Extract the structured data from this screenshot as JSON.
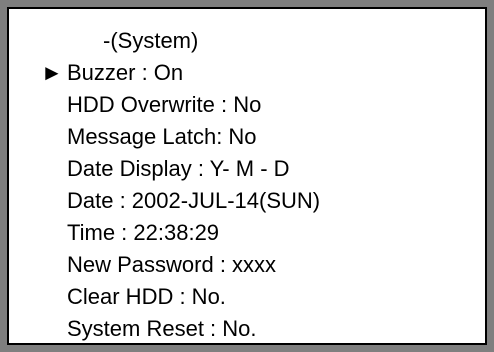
{
  "menu": {
    "title": "-(System)",
    "selected_index": 0,
    "cursor_symbol": "►",
    "items": [
      {
        "label": "Buzzer : On"
      },
      {
        "label": "HDD Overwrite : No"
      },
      {
        "label": "Message Latch: No"
      },
      {
        "label": "Date Display : Y- M - D"
      },
      {
        "label": "Date : 2002-JUL-14(SUN)"
      },
      {
        "label": "Time : 22:38:29"
      },
      {
        "label": "New Password : xxxx"
      },
      {
        "label": "Clear HDD : No."
      },
      {
        "label": "System Reset : No."
      }
    ]
  },
  "colors": {
    "frame": "#7f7f7f",
    "border": "#000000",
    "background": "#ffffff",
    "text": "#000000"
  }
}
